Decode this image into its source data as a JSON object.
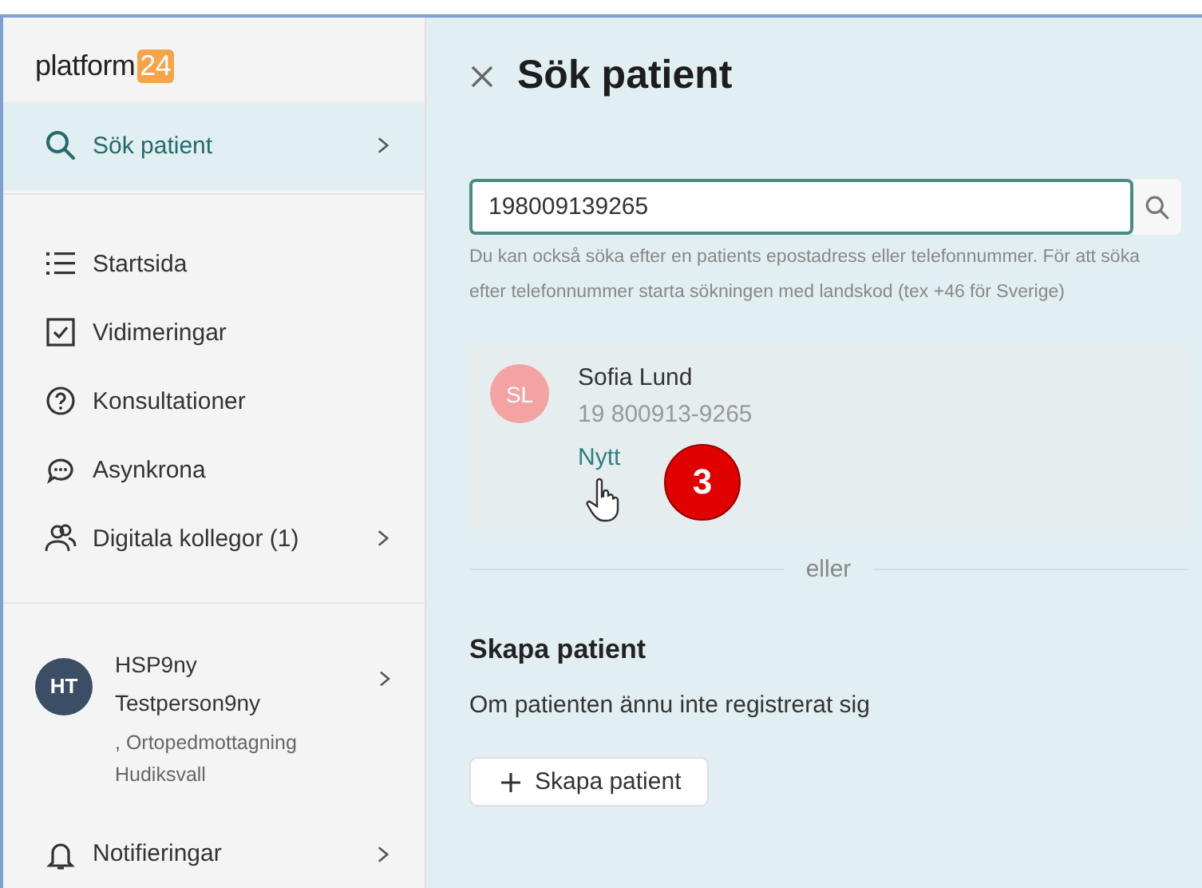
{
  "sidebar": {
    "logo": {
      "text": "platform",
      "badge": "24"
    },
    "search_item": {
      "label": "Sök patient",
      "kind": "search",
      "selected": true,
      "chevron": true
    },
    "items": [
      {
        "label": "Startsida",
        "kind": "list",
        "selected": false,
        "chevron": false
      },
      {
        "label": "Vidimeringar",
        "kind": "checkbox",
        "selected": false,
        "chevron": false
      },
      {
        "label": "Konsultationer",
        "kind": "question",
        "selected": false,
        "chevron": false
      },
      {
        "label": "Asynkrona",
        "kind": "chat",
        "selected": false,
        "chevron": false
      },
      {
        "label": "Digitala kollegor (1)",
        "kind": "people",
        "selected": false,
        "chevron": true
      }
    ],
    "user": {
      "initials": "HT",
      "name": "HSP9ny Testperson9ny",
      "unit": ", Ortopedmottagning Hudiksvall",
      "chevron": true
    },
    "notifications": {
      "label": "Notifieringar",
      "kind": "bell",
      "selected": false,
      "chevron": true
    }
  },
  "main": {
    "title": "Sök patient",
    "search": {
      "value": "198009139265"
    },
    "help": "Du kan också söka efter en patients epostadress eller telefonnummer. För att söka efter telefonnummer starta sökningen med landskod (tex +46 för Sverige)",
    "result": {
      "initials": "SL",
      "color": "#f4a3a3",
      "name": "Sofia Lund",
      "id": "19 800913-9265",
      "link": "Nytt",
      "step": "3"
    },
    "divider": "eller",
    "create": {
      "heading": "Skapa patient",
      "text": "Om patienten ännu inte registrerat sig",
      "button": "Skapa patient"
    }
  }
}
